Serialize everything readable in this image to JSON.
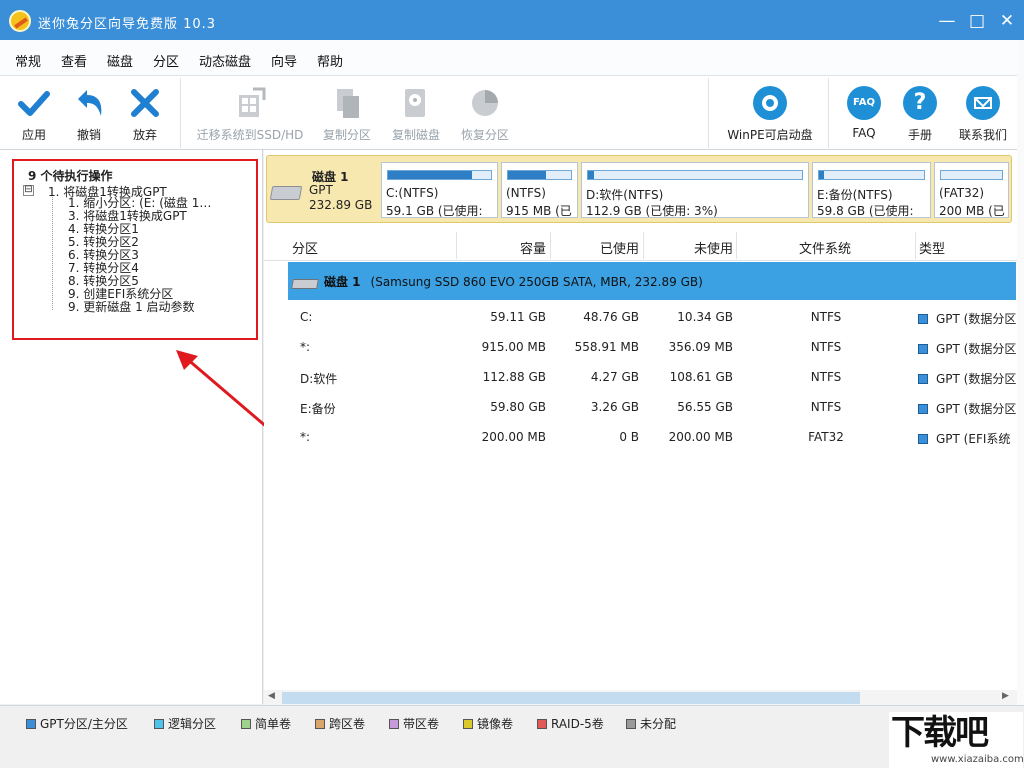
{
  "window": {
    "title": "迷你兔分区向导免费版 10.3",
    "minimize": "—",
    "maximize": "□",
    "close": "✕"
  },
  "menu": [
    "常规",
    "查看",
    "磁盘",
    "分区",
    "动态磁盘",
    "向导",
    "帮助"
  ],
  "toolbar": {
    "apply": "应用",
    "undo": "撤销",
    "discard": "放弃",
    "migrate": "迁移系统到SSD/HD",
    "copy_partition": "复制分区",
    "copy_disk": "复制磁盘",
    "recover_partition": "恢复分区",
    "winpe": "WinPE可启动盘",
    "faq": "FAQ",
    "faq_icon_text": "FAQ",
    "manual": "手册",
    "contact": "联系我们"
  },
  "pending": {
    "title": "9 个待执行操作",
    "toggle": "⊟",
    "root": "1. 将磁盘1转换成GPT",
    "items": [
      "1. 缩小分区: (E: (磁盘 1…",
      "3. 将磁盘1转换成GPT",
      "4. 转换分区1",
      "5. 转换分区2",
      "6. 转换分区3",
      "7. 转换分区4",
      "8. 转换分区5",
      "9. 创建EFI系统分区",
      "9. 更新磁盘 1 启动参数"
    ]
  },
  "disk_map": {
    "name": "磁盘 1",
    "type": "GPT",
    "size": "232.89 GB",
    "partitions": [
      {
        "name": "C:(NTFS)",
        "info": "59.1 GB (已使用:",
        "used_fraction": 0.82
      },
      {
        "name": "(NTFS)",
        "info": "915 MB (已",
        "used_fraction": 0.61
      },
      {
        "name": "D:软件(NTFS)",
        "info": "112.9 GB (已使用: 3%)",
        "used_fraction": 0.03
      },
      {
        "name": "E:备份(NTFS)",
        "info": "59.8 GB (已使用:",
        "used_fraction": 0.05
      },
      {
        "name": "(FAT32)",
        "info": "200 MB (已",
        "used_fraction": 0.0
      }
    ]
  },
  "table": {
    "headers": {
      "partition": "分区",
      "capacity": "容量",
      "used": "已使用",
      "unused": "未使用",
      "fs": "文件系统",
      "type": "类型"
    },
    "disk_row": {
      "name": "磁盘 1",
      "detail": "(Samsung SSD 860 EVO 250GB SATA, MBR, 232.89 GB)"
    },
    "rows": [
      {
        "partition": "C:",
        "capacity": "59.11 GB",
        "used": "48.76 GB",
        "unused": "10.34 GB",
        "fs": "NTFS",
        "type": "GPT (数据分区"
      },
      {
        "partition": "*:",
        "capacity": "915.00 MB",
        "used": "558.91 MB",
        "unused": "356.09 MB",
        "fs": "NTFS",
        "type": "GPT (数据分区"
      },
      {
        "partition": "D:软件",
        "capacity": "112.88 GB",
        "used": "4.27 GB",
        "unused": "108.61 GB",
        "fs": "NTFS",
        "type": "GPT (数据分区"
      },
      {
        "partition": "E:备份",
        "capacity": "59.80 GB",
        "used": "3.26 GB",
        "unused": "56.55 GB",
        "fs": "NTFS",
        "type": "GPT (数据分区"
      },
      {
        "partition": "*:",
        "capacity": "200.00 MB",
        "used": "0 B",
        "unused": "200.00 MB",
        "fs": "FAT32",
        "type": "GPT (EFI系统"
      }
    ]
  },
  "legend": [
    {
      "label": "GPT分区/主分区",
      "color": "#3a8fd8"
    },
    {
      "label": "逻辑分区",
      "color": "#4cc3e8"
    },
    {
      "label": "简单卷",
      "color": "#9ed18a"
    },
    {
      "label": "跨区卷",
      "color": "#d9a56a"
    },
    {
      "label": "带区卷",
      "color": "#c99adb"
    },
    {
      "label": "镜像卷",
      "color": "#d9c92a"
    },
    {
      "label": "RAID-5卷",
      "color": "#e05a5a"
    },
    {
      "label": "未分配",
      "color": "#9a9a9a"
    }
  ],
  "scroll": {
    "left": "◀",
    "right": "▶"
  },
  "watermark": {
    "big": "下载吧",
    "small": "www.xiazaiba.com"
  }
}
